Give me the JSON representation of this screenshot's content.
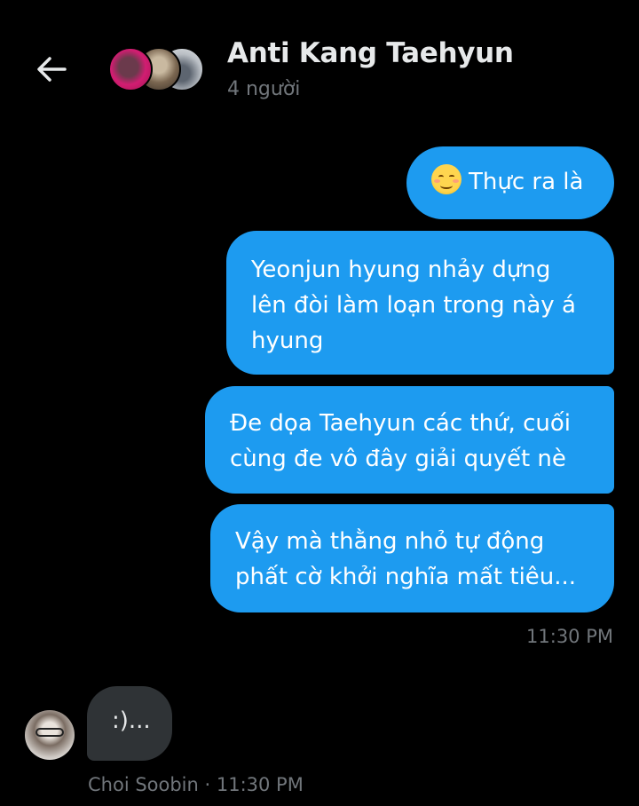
{
  "header": {
    "title": "Anti Kang Taehyun",
    "subtitle": "4 người",
    "back_icon": "arrow-left-icon"
  },
  "messages": [
    {
      "direction": "outgoing",
      "emoji": "smiling-face-emoji",
      "lines": [
        "Thực ra là"
      ]
    },
    {
      "direction": "outgoing",
      "lines": [
        "Yeonjun hyung nhảy dựng",
        "lên đòi làm loạn trong này á",
        "hyung"
      ]
    },
    {
      "direction": "outgoing",
      "lines": [
        "Đe dọa Taehyun các thứ, cuối",
        "cùng đe vô đây giải quyết nè"
      ]
    },
    {
      "direction": "outgoing",
      "lines": [
        "Vậy mà thằng nhỏ tự động",
        "phất cờ khởi nghĩa mất tiêu..."
      ]
    }
  ],
  "outgoing_time": "11:30 PM",
  "incoming": {
    "text": ":)...",
    "meta": "Choi Soobin · 11:30 PM"
  },
  "colors": {
    "background": "#000000",
    "outgoing_bubble": "#1d9bf0",
    "incoming_bubble": "#2f3336",
    "secondary_text": "#71767b"
  }
}
